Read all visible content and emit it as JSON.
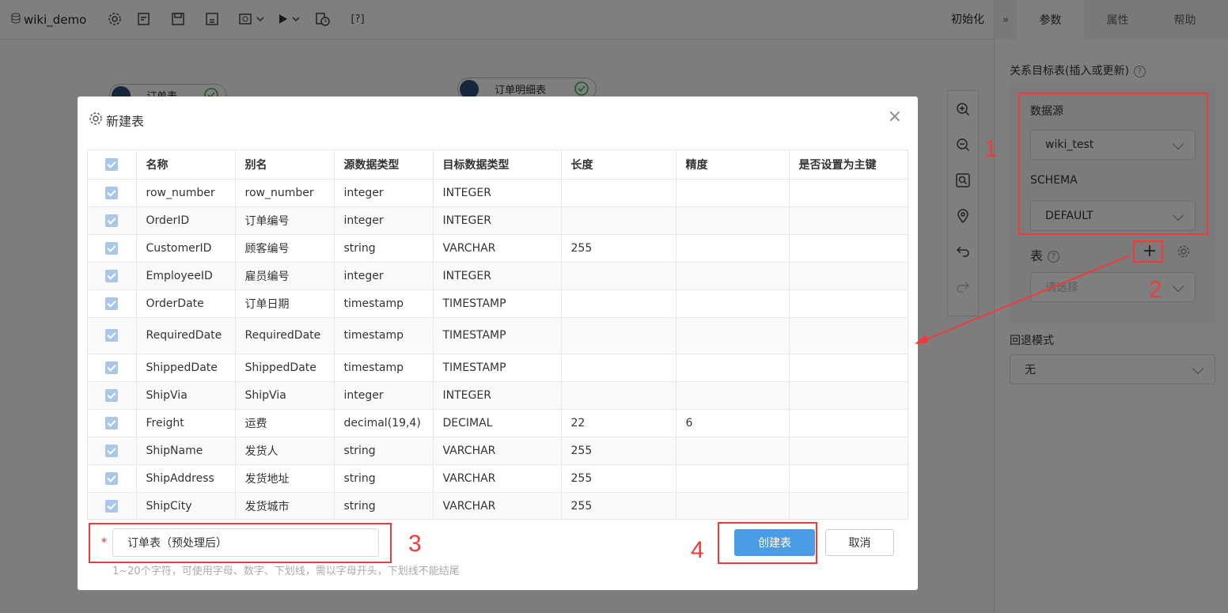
{
  "app": {
    "project_name": "wiki_demo",
    "help_bracket": "[?]",
    "init_label": "初始化"
  },
  "canvas": {
    "nodes": [
      {
        "label": "订单表"
      },
      {
        "label": "订单明细表"
      }
    ]
  },
  "right_panel": {
    "tabs": [
      "参数",
      "属性",
      "帮助"
    ],
    "target_table_label": "关系目标表(插入或更新)",
    "datasource_label": "数据源",
    "datasource_value": "wiki_test",
    "schema_label": "SCHEMA",
    "schema_value": "DEFAULT",
    "table_label": "表",
    "table_placeholder": "请选择",
    "rollback_label": "回退模式",
    "rollback_value": "无"
  },
  "dialog": {
    "title": "新建表",
    "columns": [
      "名称",
      "别名",
      "源数据类型",
      "目标数据类型",
      "长度",
      "精度",
      "是否设置为主键"
    ],
    "rows": [
      {
        "name": "row_number",
        "alias": "row_number",
        "src": "integer",
        "dst": "INTEGER",
        "len": "",
        "prec": "",
        "pk": ""
      },
      {
        "name": "OrderID",
        "alias": "订单编号",
        "src": "integer",
        "dst": "INTEGER",
        "len": "",
        "prec": "",
        "pk": ""
      },
      {
        "name": "CustomerID",
        "alias": "顾客编号",
        "src": "string",
        "dst": "VARCHAR",
        "len": "255",
        "prec": "",
        "pk": ""
      },
      {
        "name": "EmployeeID",
        "alias": "雇员编号",
        "src": "integer",
        "dst": "INTEGER",
        "len": "",
        "prec": "",
        "pk": ""
      },
      {
        "name": "OrderDate",
        "alias": "订单日期",
        "src": "timestamp",
        "dst": "TIMESTAMP",
        "len": "",
        "prec": "",
        "pk": ""
      },
      {
        "name": "RequiredDate",
        "alias": "RequiredDate",
        "src": "timestamp",
        "dst": "TIMESTAMP",
        "len": "",
        "prec": "",
        "pk": ""
      },
      {
        "name": "ShippedDate",
        "alias": "ShippedDate",
        "src": "timestamp",
        "dst": "TIMESTAMP",
        "len": "",
        "prec": "",
        "pk": ""
      },
      {
        "name": "ShipVia",
        "alias": "ShipVia",
        "src": "integer",
        "dst": "INTEGER",
        "len": "",
        "prec": "",
        "pk": ""
      },
      {
        "name": "Freight",
        "alias": "运费",
        "src": "decimal(19,4)",
        "dst": "DECIMAL",
        "len": "22",
        "prec": "6",
        "pk": ""
      },
      {
        "name": "ShipName",
        "alias": "发货人",
        "src": "string",
        "dst": "VARCHAR",
        "len": "255",
        "prec": "",
        "pk": ""
      },
      {
        "name": "ShipAddress",
        "alias": "发货地址",
        "src": "string",
        "dst": "VARCHAR",
        "len": "255",
        "prec": "",
        "pk": ""
      },
      {
        "name": "ShipCity",
        "alias": "发货城市",
        "src": "string",
        "dst": "VARCHAR",
        "len": "255",
        "prec": "",
        "pk": ""
      }
    ],
    "required_mark": "*",
    "table_name_value": "订单表（预处理后）",
    "hint": "1~20个字符，可使用字母、数字、下划线，需以字母开头，下划线不能结尾",
    "create_label": "创建表",
    "cancel_label": "取消"
  },
  "annotations": [
    "1",
    "2",
    "3",
    "4"
  ],
  "colors": {
    "annotation_red": "#ef3b3b",
    "primary_blue": "#4a9ce8",
    "checkbox_blue": "#a9c7e9",
    "node_green": "#3db34a"
  }
}
